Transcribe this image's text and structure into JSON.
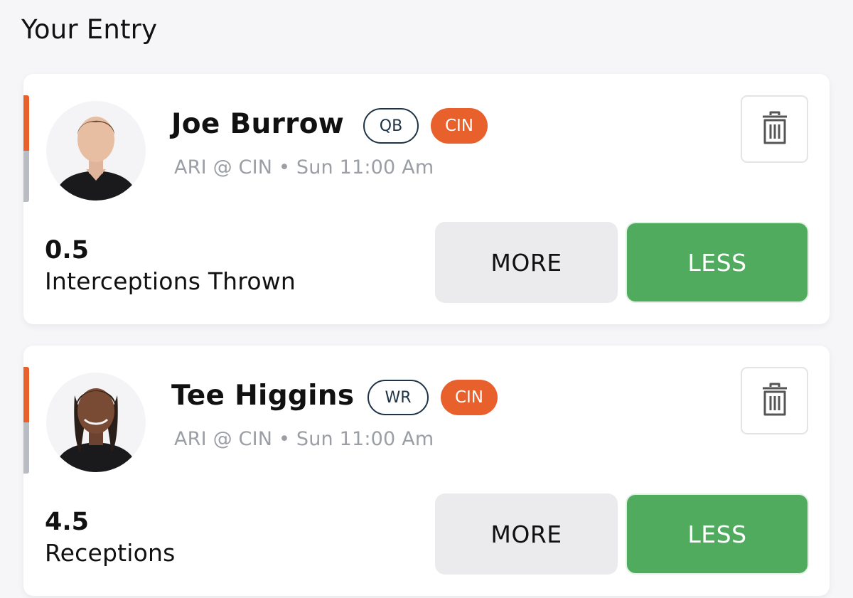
{
  "header": {
    "title": "Your Entry"
  },
  "entries": [
    {
      "player_name": "Joe Burrow",
      "position": "QB",
      "team": "CIN",
      "game_info": "ARI @ CIN • Sun 11:00 Am",
      "line_value": "0.5",
      "stat_label": "Interceptions Thrown",
      "more_label": "MORE",
      "less_label": "LESS",
      "selected": "LESS"
    },
    {
      "player_name": "Tee Higgins",
      "position": "WR",
      "team": "CIN",
      "game_info": "ARI @ CIN • Sun 11:00 Am",
      "line_value": "4.5",
      "stat_label": "Receptions",
      "more_label": "MORE",
      "less_label": "LESS",
      "selected": "LESS"
    }
  ],
  "icons": {
    "delete": "trash-icon",
    "avatar": "player-headshot"
  },
  "colors": {
    "accent_orange": "#e8602c",
    "less_green": "#50ab5f",
    "position_badge": "#1f3346",
    "muted_text": "#9b9ea4"
  }
}
